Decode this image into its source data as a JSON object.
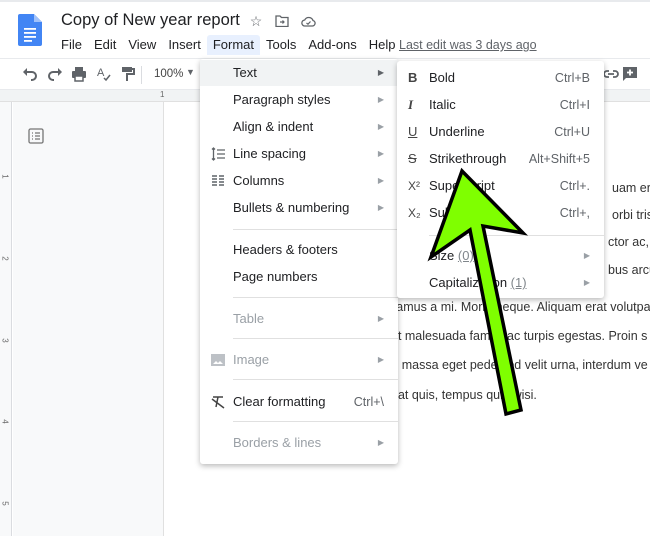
{
  "app": {
    "doc_title": "Copy of New year report",
    "title_icons": [
      "star-icon",
      "move-to-folder-icon",
      "cloud-saved-icon"
    ],
    "menu": [
      "File",
      "Edit",
      "View",
      "Insert",
      "Format",
      "Tools",
      "Add-ons",
      "Help"
    ],
    "active_menu": "Format",
    "last_edit": "Last edit was 3 days ago"
  },
  "toolbar": {
    "icons": [
      "undo-icon",
      "redo-icon",
      "print-icon",
      "spellcheck-icon",
      "paint-format-icon"
    ],
    "zoom": "100%",
    "right_icons": [
      "link-icon",
      "add-comment-icon"
    ]
  },
  "ruler": {
    "h_label": "1",
    "v_labels": [
      "1",
      "2",
      "3",
      "4",
      "5"
    ]
  },
  "format_menu": {
    "items": [
      {
        "label": "Text",
        "submenu": true,
        "highlighted": true
      },
      {
        "label": "Paragraph styles",
        "submenu": true
      },
      {
        "label": "Align & indent",
        "submenu": true
      },
      {
        "label": "Line spacing",
        "submenu": true,
        "icon": "line-spacing-icon"
      },
      {
        "label": "Columns",
        "submenu": true,
        "icon": "columns-icon"
      },
      {
        "label": "Bullets & numbering",
        "submenu": true
      },
      {
        "label": "Headers & footers"
      },
      {
        "label": "Page numbers"
      },
      {
        "label": "Table",
        "submenu": true,
        "disabled": true
      },
      {
        "label": "Image",
        "submenu": true,
        "disabled": true,
        "icon": "image-icon"
      },
      {
        "label": "Clear formatting",
        "shortcut": "Ctrl+\\",
        "icon": "clear-formatting-icon"
      },
      {
        "label": "Borders & lines",
        "submenu": true,
        "disabled": true
      }
    ]
  },
  "text_submenu": {
    "items": [
      {
        "label": "Bold",
        "shortcut": "Ctrl+B",
        "icon_glyph": "B"
      },
      {
        "label": "Italic",
        "shortcut": "Ctrl+I",
        "icon_glyph": "I"
      },
      {
        "label": "Underline",
        "shortcut": "Ctrl+U",
        "icon_glyph": "U"
      },
      {
        "label": "Strikethrough",
        "shortcut": "Alt+Shift+5",
        "icon_glyph": "S"
      },
      {
        "label": "Superscript",
        "shortcut": "Ctrl+.",
        "icon_glyph": "X²"
      },
      {
        "label": "Subscript",
        "shortcut": "Ctrl+,",
        "icon_glyph": "X₂"
      },
      {
        "label": "Size",
        "count": "(0)",
        "submenu": true
      },
      {
        "label": "Capitalization",
        "count": "(1)",
        "submenu": true
      }
    ]
  },
  "document_lines": [
    "uam erat",
    "orbi trist",
    "ctor ac, a",
    "bus arcu",
    "vamus a mi. Morbi neque. Aliquam erat volutpat",
    "et malesuada fames ac turpis egestas. Proin s",
    "c massa eget pede sed velit urna, interdum ve",
    "uat quis, tempus quis wisi."
  ],
  "annotation": {
    "type": "arrow",
    "color": "#7fff00",
    "points_to": "Strikethrough"
  }
}
